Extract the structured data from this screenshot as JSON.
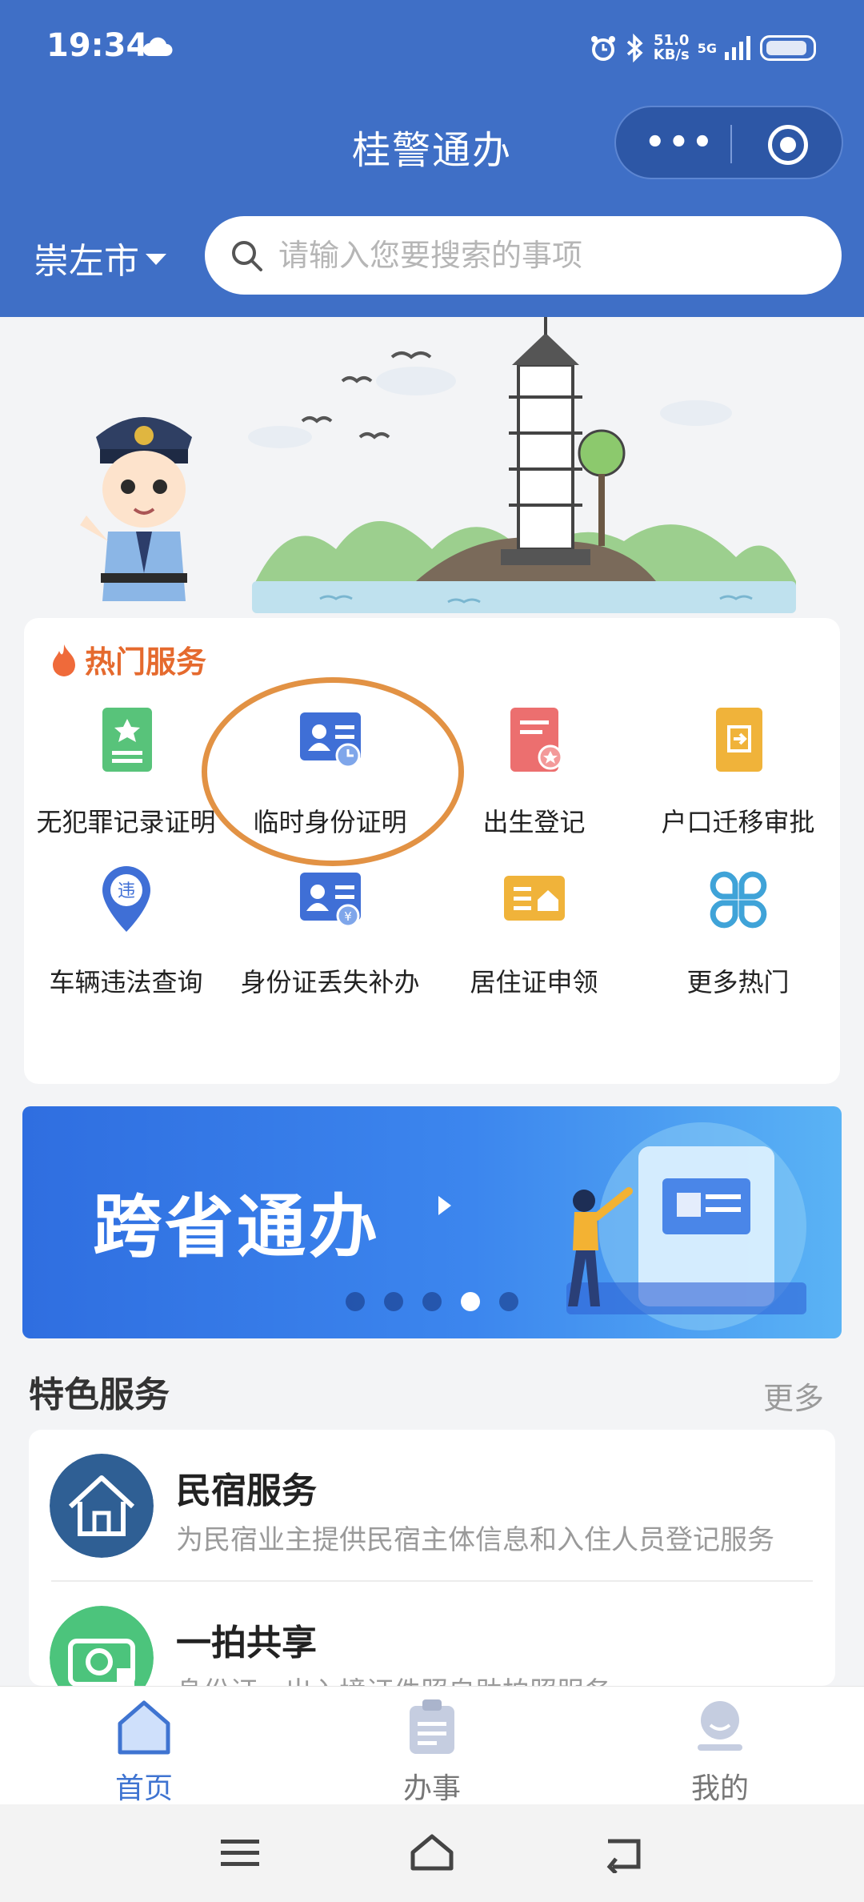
{
  "status_bar": {
    "time": "19:34",
    "net_speed_value": "51.0",
    "net_speed_unit": "KB/s",
    "network": "5G",
    "icons": [
      "cloud-icon",
      "alarm-icon",
      "bluetooth-icon",
      "signal-icon",
      "battery-icon"
    ]
  },
  "header": {
    "title": "桂警通办",
    "city": "崇左市",
    "search_placeholder": "请输入您要搜索的事项",
    "background": "#3f6fc6"
  },
  "hot_services": {
    "title": "热门服务",
    "title_color": "#e56a2e",
    "items": [
      {
        "label": "无犯罪记录证明",
        "icon": "certificate-icon"
      },
      {
        "label": "临时身份证明",
        "icon": "id-card-clock-icon"
      },
      {
        "label": "出生登记",
        "icon": "birth-register-icon"
      },
      {
        "label": "户口迁移审批",
        "icon": "migration-icon"
      },
      {
        "label": "车辆违法查询",
        "icon": "violation-pin-icon"
      },
      {
        "label": "身份证丢失补办",
        "icon": "id-card-replace-icon"
      },
      {
        "label": "居住证申领",
        "icon": "residence-permit-icon"
      },
      {
        "label": "更多热门",
        "icon": "more-grid-icon"
      }
    ]
  },
  "promo": {
    "text": "跨省通办",
    "active_dot": 4,
    "dot_count": 5
  },
  "featured": {
    "title": "特色服务",
    "more": "更多",
    "items": [
      {
        "name": "民宿服务",
        "desc": "为民宿业主提供民宿主体信息和入住人员登记服务",
        "icon": "house-icon"
      },
      {
        "name": "一拍共享",
        "desc": "身份证、出入境证件照自助拍照服务",
        "icon": "camera-icon"
      }
    ]
  },
  "tabbar": {
    "items": [
      {
        "label": "首页",
        "icon": "home-icon",
        "active": true
      },
      {
        "label": "办事",
        "icon": "clipboard-icon",
        "active": false
      },
      {
        "label": "我的",
        "icon": "user-icon",
        "active": false
      }
    ],
    "active_color": "#3f74d1"
  },
  "system_nav": [
    "menu-icon",
    "home-outline-icon",
    "back-icon"
  ]
}
